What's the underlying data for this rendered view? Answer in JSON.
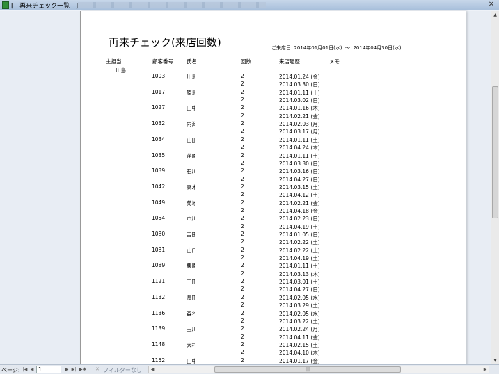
{
  "window": {
    "title": "[   再来チェック一覧   ]"
  },
  "report": {
    "title": "再来チェック(来店回数)",
    "period_label": "ご来店日",
    "period_from": "2014年01月01日(水)",
    "period_sep": "〜",
    "period_to": "2014年04月30日(水)"
  },
  "columns": {
    "manager": "主担当",
    "customer_no": "顧客番号",
    "name": "氏名",
    "count": "回数",
    "history": "来店履歴",
    "memo": "メモ"
  },
  "manager_name": "川島",
  "records": [
    {
      "no": "1003",
      "name": "川島",
      "count": "2",
      "dates": [
        "2014.01.24 (金)",
        "2014.03.30 (日)"
      ]
    },
    {
      "no": "1017",
      "name": "原島",
      "count": "2",
      "dates": [
        "2014.01.11 (土)",
        "2014.03.02 (日)"
      ]
    },
    {
      "no": "1027",
      "name": "田中",
      "count": "2",
      "dates": [
        "2014.01.16 (木)",
        "2014.02.21 (金)"
      ]
    },
    {
      "no": "1032",
      "name": "内海",
      "count": "2",
      "dates": [
        "2014.02.03 (月)",
        "2014.03.17 (月)"
      ]
    },
    {
      "no": "1034",
      "name": "山田",
      "count": "2",
      "dates": [
        "2014.01.11 (土)",
        "2014.04.24 (木)"
      ]
    },
    {
      "no": "1035",
      "name": "荏原",
      "count": "2",
      "dates": [
        "2014.01.11 (土)",
        "2014.03.30 (日)"
      ]
    },
    {
      "no": "1039",
      "name": "石川",
      "count": "2",
      "dates": [
        "2014.03.16 (日)",
        "2014.04.27 (日)"
      ]
    },
    {
      "no": "1042",
      "name": "高木",
      "count": "2",
      "dates": [
        "2014.03.15 (土)",
        "2014.04.12 (土)"
      ]
    },
    {
      "no": "1049",
      "name": "菊地",
      "count": "2",
      "dates": [
        "2014.02.21 (金)",
        "2014.04.18 (金)"
      ]
    },
    {
      "no": "1054",
      "name": "市川",
      "count": "2",
      "dates": [
        "2014.02.23 (日)",
        "2014.04.19 (土)"
      ]
    },
    {
      "no": "1080",
      "name": "吉田",
      "count": "2",
      "dates": [
        "2014.01.05 (日)",
        "2014.02.22 (土)"
      ]
    },
    {
      "no": "1081",
      "name": "山口",
      "count": "2",
      "dates": [
        "2014.02.22 (土)",
        "2014.04.19 (土)"
      ]
    },
    {
      "no": "1089",
      "name": "栗原",
      "count": "2",
      "dates": [
        "2014.01.11 (土)",
        "2014.03.13 (木)"
      ]
    },
    {
      "no": "1121",
      "name": "三田",
      "count": "2",
      "dates": [
        "2014.03.01 (土)",
        "2014.04.27 (日)"
      ]
    },
    {
      "no": "1132",
      "name": "長田",
      "count": "2",
      "dates": [
        "2014.02.05 (水)",
        "2014.03.29 (土)"
      ]
    },
    {
      "no": "1136",
      "name": "森谷",
      "count": "2",
      "dates": [
        "2014.02.05 (水)",
        "2014.03.22 (土)"
      ]
    },
    {
      "no": "1139",
      "name": "玉川",
      "count": "2",
      "dates": [
        "2014.02.24 (月)",
        "2014.04.11 (金)"
      ]
    },
    {
      "no": "1148",
      "name": "大村",
      "count": "2",
      "dates": [
        "2014.02.15 (土)",
        "2014.04.10 (木)"
      ]
    },
    {
      "no": "1152",
      "name": "田中",
      "count": "2",
      "dates": [
        "2014.01.17 (金)"
      ]
    }
  ],
  "navbar": {
    "page_label": "ページ:",
    "page_value": "1",
    "filter_label": "フィルターなし"
  }
}
